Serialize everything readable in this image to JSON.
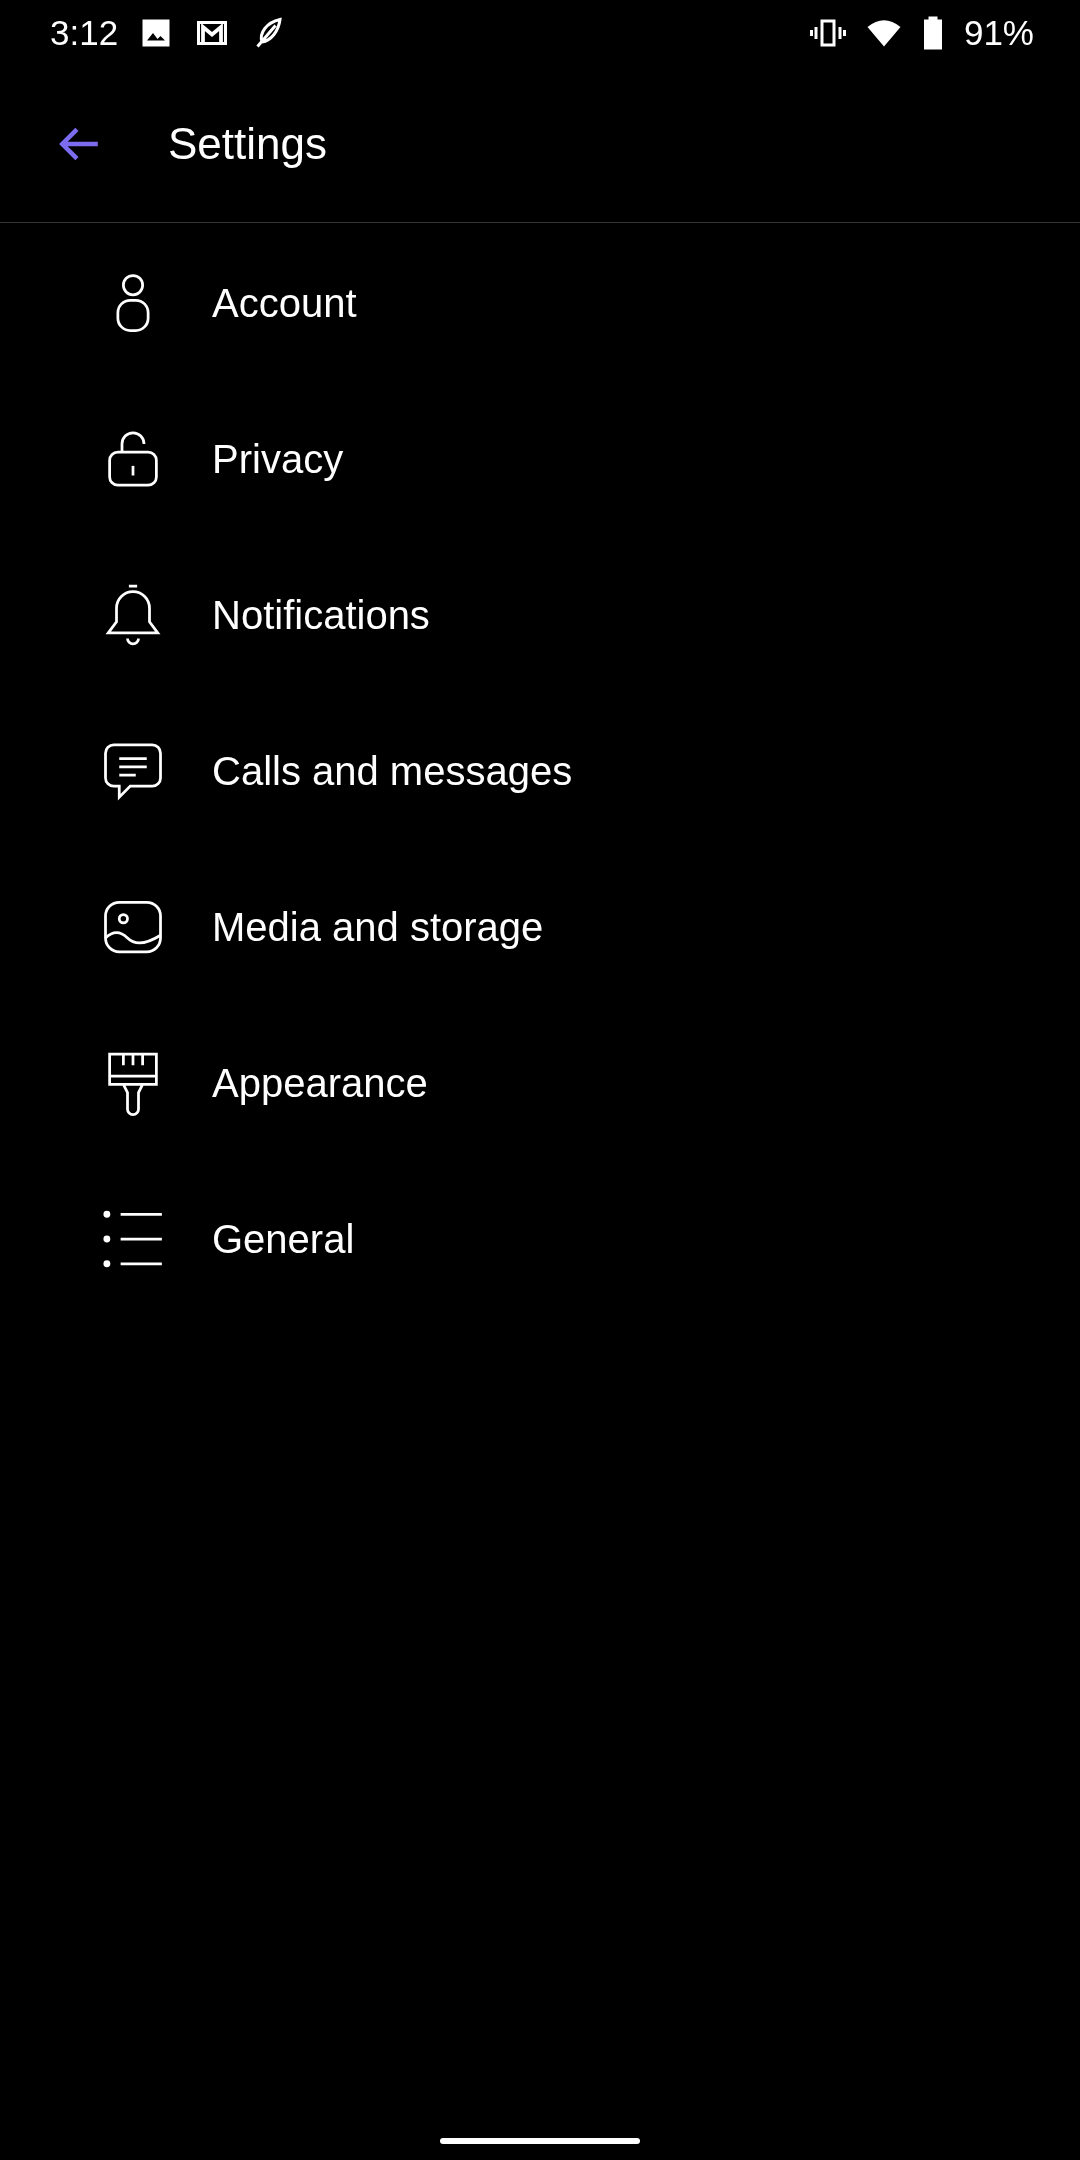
{
  "status_bar": {
    "time": "3:12",
    "battery": "91%"
  },
  "app_bar": {
    "title": "Settings"
  },
  "items": [
    {
      "kind": "account",
      "label": "Account"
    },
    {
      "kind": "privacy",
      "label": "Privacy"
    },
    {
      "kind": "notifications",
      "label": "Notifications"
    },
    {
      "kind": "chats",
      "label": "Calls and messages"
    },
    {
      "kind": "media",
      "label": "Media and storage"
    },
    {
      "kind": "appearance",
      "label": "Appearance"
    },
    {
      "kind": "general",
      "label": "General"
    }
  ]
}
